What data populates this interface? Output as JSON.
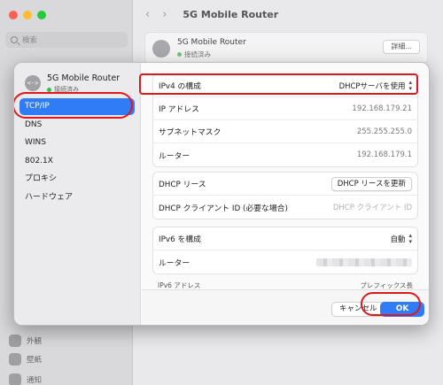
{
  "background": {
    "search_placeholder": "検索",
    "sidebar_items": [
      "外観",
      "壁紙",
      "通知"
    ],
    "title": "5G Mobile Router",
    "card": {
      "name": "5G Mobile Router",
      "status": "接続済み",
      "details_button": "詳細..."
    }
  },
  "dialog": {
    "header": {
      "name": "5G Mobile Router",
      "status": "接続済み",
      "icon": "<·>"
    },
    "sidebar": [
      "TCP/IP",
      "DNS",
      "WINS",
      "802.1X",
      "プロキシ",
      "ハードウェア"
    ],
    "ipv4": {
      "configure_label": "IPv4 の構成",
      "configure_value": "DHCPサーバを使用",
      "ip_label": "IP アドレス",
      "ip_value": "192.168.179.21",
      "subnet_label": "サブネットマスク",
      "subnet_value": "255.255.255.0",
      "router_label": "ルーター",
      "router_value": "192.168.179.1"
    },
    "dhcp": {
      "lease_label": "DHCP リース",
      "renew_button": "DHCP リースを更新",
      "client_id_label": "DHCP クライアント ID (必要な場合)",
      "client_id_placeholder": "DHCP クライアント ID"
    },
    "ipv6": {
      "configure_label": "IPv6 を構成",
      "configure_value": "自動",
      "router_label": "ルーター",
      "address_header": "IPv6 アドレス",
      "prefix_header": "プレフィックス長"
    },
    "footer": {
      "cancel": "キャンセル",
      "ok": "OK"
    }
  },
  "colors": {
    "accent": "#2f7cf6",
    "annotation": "#e0181e"
  }
}
